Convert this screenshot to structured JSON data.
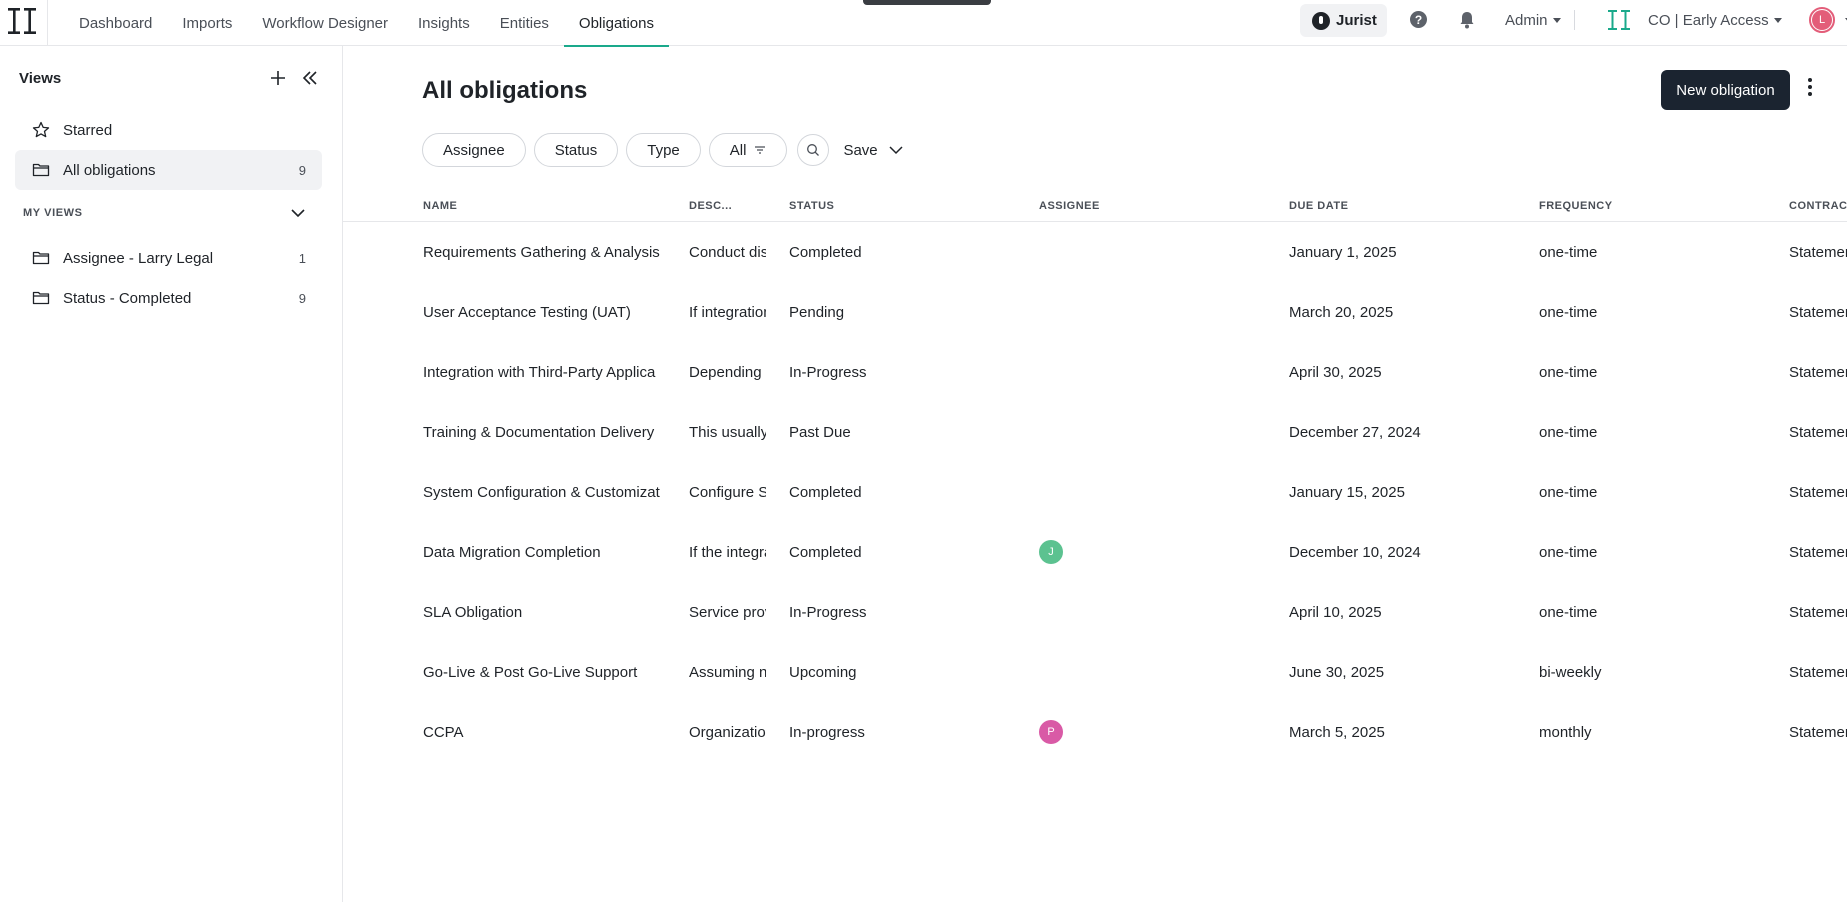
{
  "nav": {
    "items": [
      {
        "label": "Dashboard",
        "active": false
      },
      {
        "label": "Imports",
        "active": false
      },
      {
        "label": "Workflow Designer",
        "active": false
      },
      {
        "label": "Insights",
        "active": false
      },
      {
        "label": "Entities",
        "active": false
      },
      {
        "label": "Obligations",
        "active": true
      }
    ],
    "jurist_label": "Jurist",
    "help_glyph": "?",
    "admin_label": "Admin",
    "org_label": "CO | Early Access",
    "user_initial": "L",
    "accent_color": "#1aa98b"
  },
  "sidebar": {
    "title": "Views",
    "starred_label": "Starred",
    "all_label": "All obligations",
    "all_count": "9",
    "my_views_label": "MY VIEWS",
    "my_views": [
      {
        "label": "Assignee - Larry Legal",
        "count": "1"
      },
      {
        "label": "Status - Completed",
        "count": "9"
      }
    ]
  },
  "main": {
    "title": "All obligations",
    "new_button": "New obligation",
    "filters": [
      "Assignee",
      "Status",
      "Type",
      "All"
    ],
    "save_label": "Save",
    "columns": [
      "NAME",
      "DESC...",
      "STATUS",
      "ASSIGNEE",
      "DUE DATE",
      "FREQUENCY",
      "CONTRAC"
    ],
    "rows": [
      {
        "name": "Requirements Gathering & Analysis",
        "desc": "Conduct dis",
        "status": "Completed",
        "assignee": "",
        "assignee_color": "",
        "due": "January 1, 2025",
        "freq": "one-time",
        "contract": "Statemen"
      },
      {
        "name": "User Acceptance Testing (UAT)",
        "desc": "If integration",
        "status": "Pending",
        "assignee": "",
        "assignee_color": "",
        "due": "March 20, 2025",
        "freq": "one-time",
        "contract": "Statemen"
      },
      {
        "name": "Integration with Third-Party Applica",
        "desc": "Depending o",
        "status": "In-Progress",
        "assignee": "",
        "assignee_color": "",
        "due": "April 30, 2025",
        "freq": "one-time",
        "contract": "Statemen"
      },
      {
        "name": "Training & Documentation Delivery",
        "desc": "This usually",
        "status": "Past Due",
        "assignee": "",
        "assignee_color": "",
        "due": "December 27, 2024",
        "freq": "one-time",
        "contract": "Statemen"
      },
      {
        "name": "System Configuration & Customizat",
        "desc": "Configure S",
        "status": "Completed",
        "assignee": "",
        "assignee_color": "",
        "due": "January 15, 2025",
        "freq": "one-time",
        "contract": "Statemen"
      },
      {
        "name": "Data Migration Completion",
        "desc": "If the integra",
        "status": "Completed",
        "assignee": "J",
        "assignee_color": "#5cc290",
        "due": "December 10, 2024",
        "freq": "one-time",
        "contract": "Statemen"
      },
      {
        "name": "SLA Obligation",
        "desc": "Service prov",
        "status": "In-Progress",
        "assignee": "",
        "assignee_color": "",
        "due": "April 10, 2025",
        "freq": "one-time",
        "contract": "Statemen"
      },
      {
        "name": "Go-Live & Post Go-Live Support",
        "desc": "Assuming n",
        "status": "Upcoming",
        "assignee": "",
        "assignee_color": "",
        "due": "June 30, 2025",
        "freq": "bi-weekly",
        "contract": "Statemen"
      },
      {
        "name": "CCPA",
        "desc": "Organization",
        "status": "In-progress",
        "assignee": "P",
        "assignee_color": "#d95aa6",
        "due": "March 5, 2025",
        "freq": "monthly",
        "contract": "Statemen"
      }
    ]
  }
}
